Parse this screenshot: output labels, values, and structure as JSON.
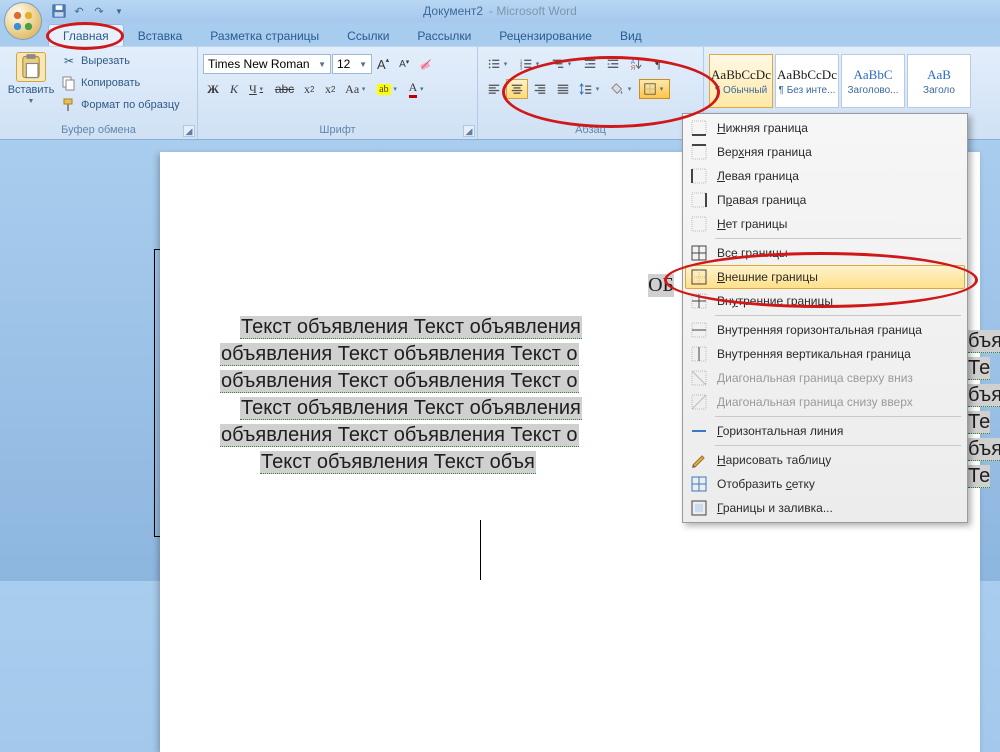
{
  "titlebar": {
    "doc_name": "Документ2",
    "app_name": "Microsoft Word"
  },
  "tabs": [
    {
      "label": "Главная",
      "active": true
    },
    {
      "label": "Вставка"
    },
    {
      "label": "Разметка страницы"
    },
    {
      "label": "Ссылки"
    },
    {
      "label": "Рассылки"
    },
    {
      "label": "Рецензирование"
    },
    {
      "label": "Вид"
    }
  ],
  "ribbon": {
    "clipboard": {
      "label": "Буфер обмена",
      "paste": "Вставить",
      "cut": "Вырезать",
      "copy": "Копировать",
      "format_painter": "Формат по образцу"
    },
    "font": {
      "label": "Шрифт",
      "family": "Times New Roman",
      "size": "12"
    },
    "paragraph": {
      "label": "Абзац"
    },
    "styles": {
      "items": [
        {
          "preview": "AaBbCcDc",
          "name": "¶ Обычный",
          "selected": true
        },
        {
          "preview": "AaBbCcDc",
          "name": "¶ Без инте..."
        },
        {
          "preview": "AaBbC",
          "name": "Заголово...",
          "blue": true
        },
        {
          "preview": "AaB",
          "name": "Заголо",
          "blue": true
        }
      ]
    }
  },
  "borders_menu": {
    "items": [
      {
        "id": "bottom",
        "label": "Нижняя граница",
        "u": 0
      },
      {
        "id": "top",
        "label": "Верхняя граница",
        "u": 3
      },
      {
        "id": "left",
        "label": "Левая граница",
        "u": 0
      },
      {
        "id": "right",
        "label": "Правая граница",
        "u": 1
      },
      {
        "id": "none",
        "label": "Нет границы",
        "u": 0
      },
      {
        "sep": true
      },
      {
        "id": "all",
        "label": "Все границы",
        "u": 1
      },
      {
        "id": "outer",
        "label": "Внешние границы",
        "u": 0,
        "hover": true
      },
      {
        "id": "inner",
        "label": "Внутренние границы",
        "u": 2
      },
      {
        "sep": true
      },
      {
        "id": "inner-h",
        "label": "Внутренняя горизонтальная граница"
      },
      {
        "id": "inner-v",
        "label": "Внутренняя вертикальная граница"
      },
      {
        "id": "diag-down",
        "label": "Диагональная граница сверху вниз",
        "disabled": true
      },
      {
        "id": "diag-up",
        "label": "Диагональная граница снизу вверх",
        "disabled": true
      },
      {
        "sep": true
      },
      {
        "id": "hline",
        "label": "Горизонтальная линия",
        "u": 0
      },
      {
        "sep": true
      },
      {
        "id": "draw",
        "label": "Нарисовать таблицу",
        "u": 0
      },
      {
        "id": "grid",
        "label": "Отобразить сетку",
        "u": 11
      },
      {
        "id": "dialog",
        "label": "Границы и заливка...",
        "u": 0
      }
    ]
  },
  "document": {
    "heading_partial": "ОБ",
    "lines": [
      "Текст объявления  Текст объявления",
      "объявления  Текст объявления  Текст о",
      "объявления  Текст объявления  Текст о",
      "Текст объявления  Текст объявления",
      "объявления  Текст объявления  Текст о",
      "Текст объявления  Текст объя"
    ],
    "right_lines": [
      "бъявления  Те",
      "бъявления  Те",
      "бъявления  Те"
    ]
  }
}
